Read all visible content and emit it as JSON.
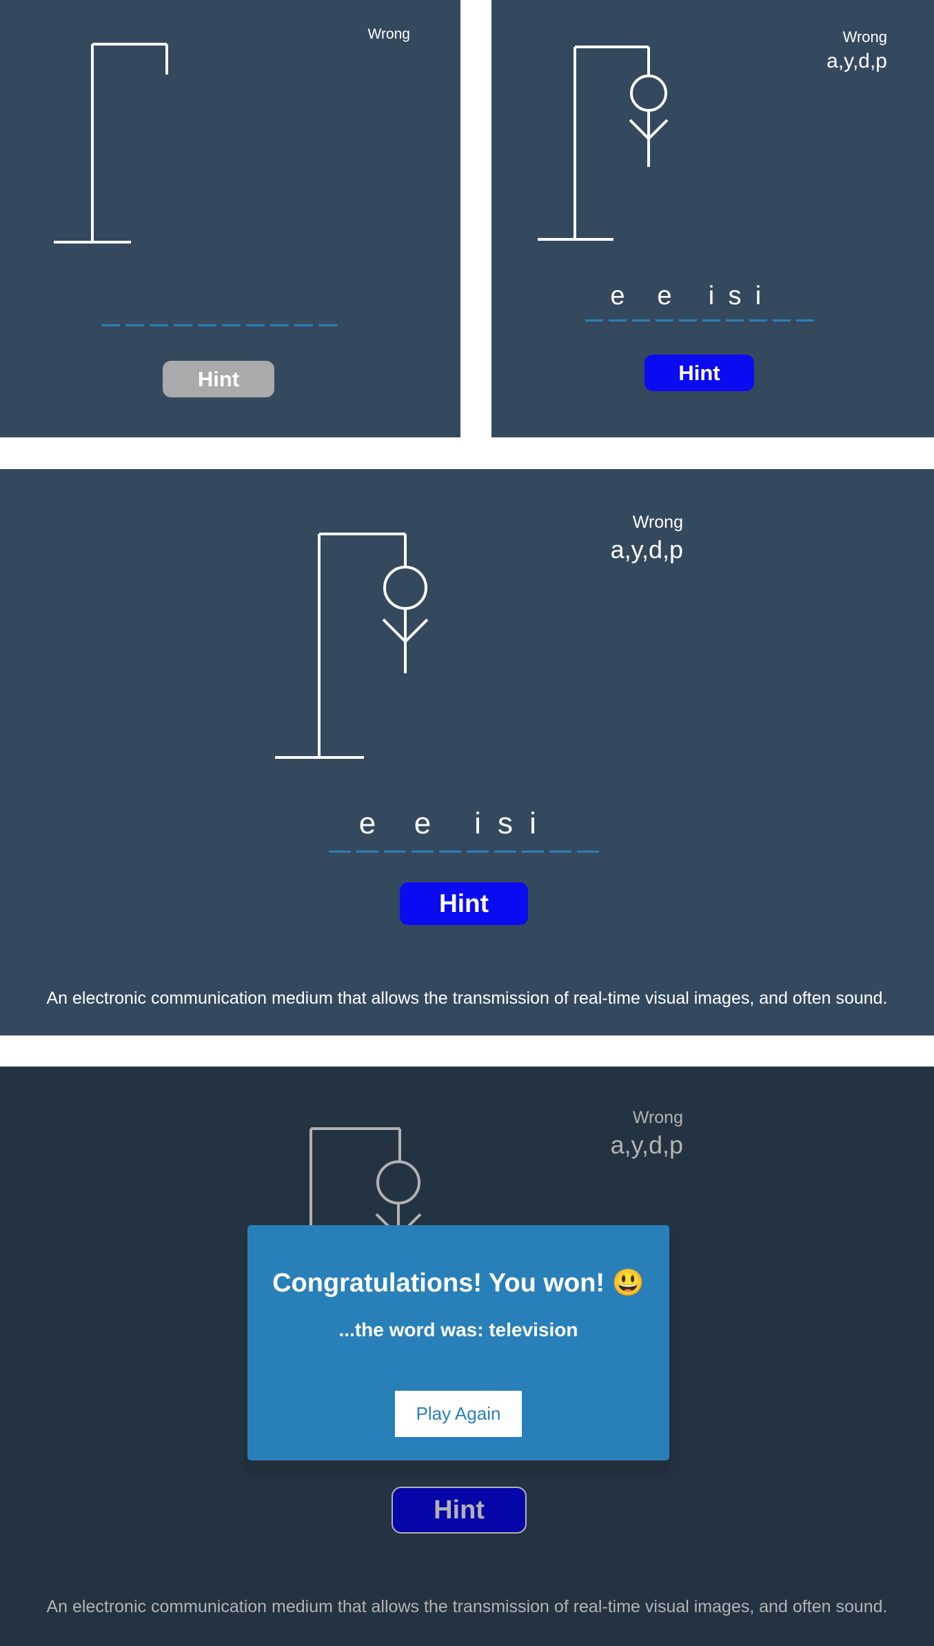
{
  "colors": {
    "background": "#34495e",
    "accent": "#2980b9",
    "hint_active": "#0b0bf2",
    "hint_disabled": "#aaaaaa",
    "white": "#ffffff"
  },
  "states": [
    {
      "wrong_label": "Wrong",
      "wrong_letters": "",
      "word_letters": [
        "",
        "",
        "",
        "",
        "",
        "",
        "",
        "",
        "",
        ""
      ],
      "hint_label": "Hint",
      "hint_text": "",
      "hangman_parts": [
        "gallows"
      ]
    },
    {
      "wrong_label": "Wrong",
      "wrong_letters": "a,y,d,p",
      "word_letters": [
        "",
        "e",
        "",
        "e",
        "",
        "i",
        "s",
        "i",
        "",
        ""
      ],
      "hint_label": "Hint",
      "hint_text": "",
      "hangman_parts": [
        "gallows",
        "head",
        "body",
        "left-arm",
        "right-arm"
      ]
    },
    {
      "wrong_label": "Wrong",
      "wrong_letters": "a,y,d,p",
      "word_letters": [
        "",
        "e",
        "",
        "e",
        "",
        "i",
        "s",
        "i",
        "",
        ""
      ],
      "hint_label": "Hint",
      "hint_text": "An electronic communication medium that allows the transmission of real-time visual images, and often sound.",
      "hangman_parts": [
        "gallows",
        "head",
        "body",
        "left-arm",
        "right-arm"
      ]
    },
    {
      "wrong_label": "Wrong",
      "wrong_letters": "a,y,d,p",
      "hint_label": "Hint",
      "hint_text": "An electronic communication medium that allows the transmission of real-time visual images, and often sound.",
      "popup": {
        "title": "Congratulations! You won! 😃",
        "message": "...the word was: television",
        "button_label": "Play Again"
      }
    }
  ]
}
